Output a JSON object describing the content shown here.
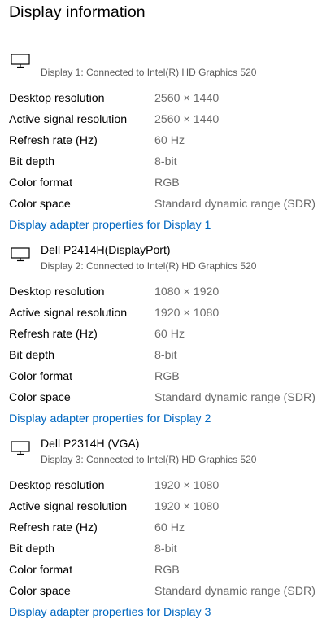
{
  "page": {
    "title": "Display information"
  },
  "icons": {
    "monitor": "monitor-icon"
  },
  "displays": [
    {
      "name": "",
      "connection": "Display 1: Connected to Intel(R) HD Graphics 520",
      "rows": [
        {
          "label": "Desktop resolution",
          "value": "2560 × 1440"
        },
        {
          "label": "Active signal resolution",
          "value": "2560 × 1440"
        },
        {
          "label": "Refresh rate (Hz)",
          "value": "60 Hz"
        },
        {
          "label": "Bit depth",
          "value": "8-bit"
        },
        {
          "label": "Color format",
          "value": "RGB"
        },
        {
          "label": "Color space",
          "value": "Standard dynamic range (SDR)"
        }
      ],
      "link": "Display adapter properties for Display 1"
    },
    {
      "name": "Dell P2414H(DisplayPort)",
      "connection": "Display 2: Connected to Intel(R) HD Graphics 520",
      "rows": [
        {
          "label": "Desktop resolution",
          "value": "1080 × 1920"
        },
        {
          "label": "Active signal resolution",
          "value": "1920 × 1080"
        },
        {
          "label": "Refresh rate (Hz)",
          "value": "60 Hz"
        },
        {
          "label": "Bit depth",
          "value": "8-bit"
        },
        {
          "label": "Color format",
          "value": "RGB"
        },
        {
          "label": "Color space",
          "value": "Standard dynamic range (SDR)"
        }
      ],
      "link": "Display adapter properties for Display 2"
    },
    {
      "name": "Dell P2314H (VGA)",
      "connection": "Display 3: Connected to Intel(R) HD Graphics 520",
      "rows": [
        {
          "label": "Desktop resolution",
          "value": "1920 × 1080"
        },
        {
          "label": "Active signal resolution",
          "value": "1920 × 1080"
        },
        {
          "label": "Refresh rate (Hz)",
          "value": "60 Hz"
        },
        {
          "label": "Bit depth",
          "value": "8-bit"
        },
        {
          "label": "Color format",
          "value": "RGB"
        },
        {
          "label": "Color space",
          "value": "Standard dynamic range (SDR)"
        }
      ],
      "link": "Display adapter properties for Display 3"
    }
  ],
  "colors": {
    "link": "#0067c0",
    "value_text": "#6b6b6b",
    "subtext": "#5a5a5a"
  }
}
